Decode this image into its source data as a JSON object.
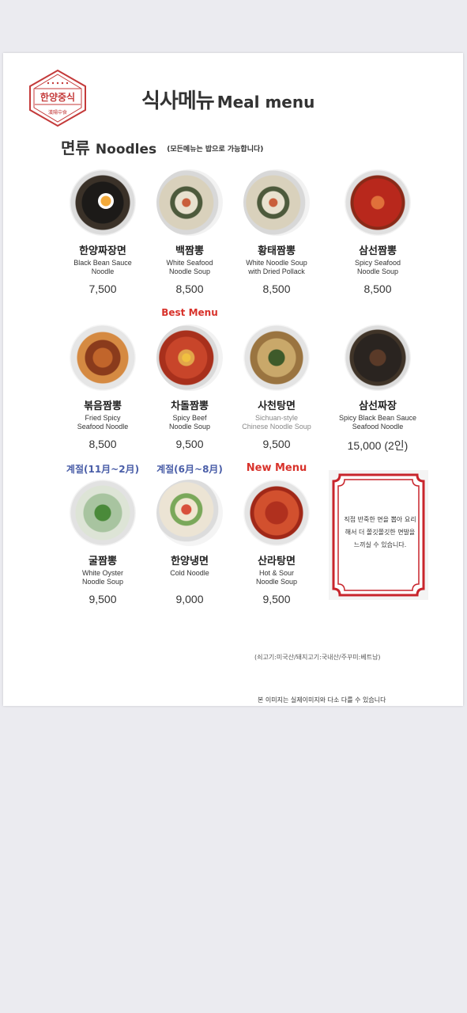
{
  "header": {
    "logo_ko": "한양중식",
    "logo_han": "漢陽中食",
    "title_ko": "식사메뉴",
    "title_en": "Meal menu"
  },
  "section": {
    "title_ko": "면류",
    "title_en": "Noodles",
    "note": "(모든메뉴는 밥으로 가능합니다)"
  },
  "items": [
    {
      "name": "한양짜장면",
      "desc": "Black Bean Sauce\nNoodle",
      "price": "7,500",
      "tag": ""
    },
    {
      "name": "백짬뽕",
      "desc": "White Seafood\nNoodle Soup",
      "price": "8,500",
      "tag": ""
    },
    {
      "name": "황태짬뽕",
      "desc": "White Noodle Soup\nwith Dried Pollack",
      "price": "8,500",
      "tag": ""
    },
    {
      "name": "삼선짬뽕",
      "desc": "Spicy Seafood\nNoodle Soup",
      "price": "8,500",
      "tag": ""
    },
    {
      "name": "볶음짬뽕",
      "desc": "Fried Spicy\nSeafood Noodle",
      "price": "8,500",
      "tag": ""
    },
    {
      "name": "차돌짬뽕",
      "desc": "Spicy Beef\nNoodle Soup",
      "price": "9,500",
      "tag": "Best Menu"
    },
    {
      "name": "사천탕면",
      "desc": "Sichuan-style\nChinese Noodle Soup",
      "price": "9,500",
      "tag": ""
    },
    {
      "name": "삼선짜장",
      "desc": "Spicy Black Bean Sauce\nSeafood Noodle",
      "price": "15,000 (2인)",
      "tag": ""
    },
    {
      "name": "굴짬뽕",
      "desc": "White Oyster\nNoodle Soup",
      "price": "9,500",
      "tag": "계절(11月~2月)"
    },
    {
      "name": "한양냉면",
      "desc": "Cold Noodle",
      "price": "9,000",
      "tag": "계절(6月~8月)"
    },
    {
      "name": "산라탕면",
      "desc": "Hot & Sour\nNoodle Soup",
      "price": "9,500",
      "tag": "New Menu"
    }
  ],
  "note_box": "직접 반죽한 면을 뽑아 요리해서 더 쫄깃쫄깃한 면발을 느끼실 수 있습니다.",
  "footer": {
    "origin": "(쇠고기:미국산/돼지고기:국내산/주꾸미:베트남)",
    "disclaimer": "본 이미지는 실제이미지와 다소 다를 수 있습니다"
  },
  "colors": {
    "logo_red": "#c43a3a",
    "best_tag": "#d8322b",
    "season_tag": "#4a5ea8",
    "frame_red": "#c8252c"
  },
  "icons": [
    "logo-emblem",
    "dish-photo",
    "ornate-frame"
  ]
}
